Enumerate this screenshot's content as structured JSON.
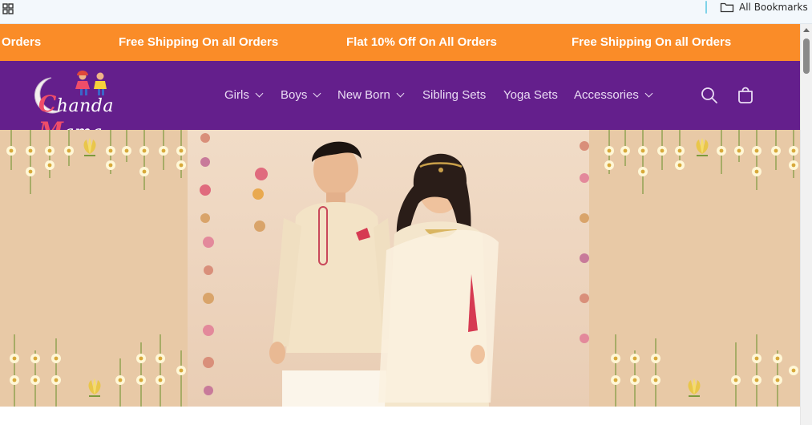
{
  "browser": {
    "apps_icon": "apps-grid-icon",
    "bookmarks_folder_icon": "folder-icon",
    "bookmarks_label": "All Bookmarks"
  },
  "announcement": {
    "messages": [
      "Orders",
      "Free Shipping On all Orders",
      "Flat 10% Off On All Orders",
      "Free Shipping On all Orders"
    ],
    "background": "#fa8c28"
  },
  "header": {
    "logo_text_1": "handa",
    "logo_text_c": "C",
    "logo_text_m": "M",
    "logo_text_2": "ama",
    "background": "#641f8c",
    "nav": [
      {
        "label": "Girls",
        "has_dropdown": true
      },
      {
        "label": "Boys",
        "has_dropdown": true
      },
      {
        "label": "New Born",
        "has_dropdown": true
      },
      {
        "label": "Sibling Sets",
        "has_dropdown": false
      },
      {
        "label": "Yoga Sets",
        "has_dropdown": false
      },
      {
        "label": "Accessories",
        "has_dropdown": true
      }
    ],
    "search_icon": "search-icon",
    "cart_icon": "cart-icon"
  },
  "hero": {
    "image": "Two children in cream ethnic outfits standing together"
  }
}
